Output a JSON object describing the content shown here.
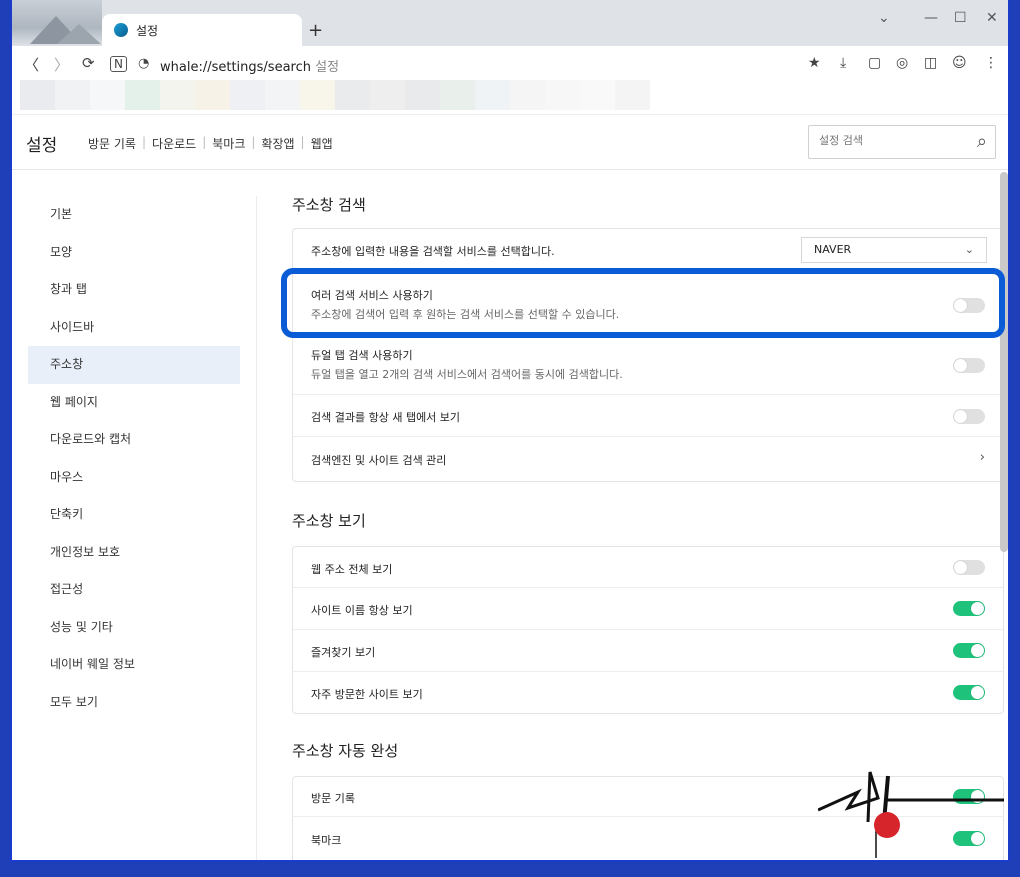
{
  "tab": {
    "title": "설정",
    "new_tab": "+"
  },
  "window_controls": {
    "dropdown": "⌄",
    "minimize": "—",
    "maximize": "☐",
    "close": "✕"
  },
  "addressbar": {
    "url_main": "whale://settings/search",
    "url_sub": "설정"
  },
  "bookmark_colors": [
    "#e9ebee",
    "#f1f2f4",
    "#f6f7f9",
    "#e4f1ea",
    "#f4f4ee",
    "#f7f2e8",
    "#eef0f4",
    "#f3f4f6",
    "#f8f5ea",
    "#eaebed",
    "#eeeeee",
    "#e8eaec",
    "#e9f0ec",
    "#f0f3f5",
    "#f5f5f5",
    "#f7f7f7",
    "#f9f9f9",
    "#f4f4f4"
  ],
  "header": {
    "title": "설정",
    "links": [
      "방문 기록",
      "다운로드",
      "북마크",
      "확장앱",
      "웹앱"
    ],
    "search_placeholder": "설정 검색"
  },
  "sidebar": {
    "items": [
      {
        "label": "기본"
      },
      {
        "label": "모양"
      },
      {
        "label": "창과 탭"
      },
      {
        "label": "사이드바"
      },
      {
        "label": "주소창",
        "active": true
      },
      {
        "label": "웹 페이지"
      },
      {
        "label": "다운로드와 캡처"
      },
      {
        "label": "마우스"
      },
      {
        "label": "단축키"
      },
      {
        "label": "개인정보 보호"
      },
      {
        "label": "접근성"
      },
      {
        "label": "성능 및 기타"
      },
      {
        "label": "네이버 웨일 정보"
      },
      {
        "label": "모두 보기"
      }
    ]
  },
  "sections": {
    "search": {
      "title": "주소창 검색",
      "engine_label": "주소창에 입력한 내용을 검색할 서비스를 선택합니다.",
      "engine_value": "NAVER",
      "multi_label": "여러 검색 서비스 사용하기",
      "multi_sub": "주소창에 검색어 입력 후 원하는 검색 서비스를 선택할 수 있습니다.",
      "dual_label": "듀얼 탭 검색 사용하기",
      "dual_sub": "듀얼 탭을 열고 2개의 검색 서비스에서 검색어를 동시에 검색합니다.",
      "newtab_label": "검색 결과를 항상 새 탭에서 보기",
      "manage_label": "검색엔진 및 사이트 검색 관리"
    },
    "view": {
      "title": "주소창 보기",
      "rows": [
        {
          "label": "웹 주소 전체 보기",
          "on": false
        },
        {
          "label": "사이트 이름 항상 보기",
          "on": true
        },
        {
          "label": "즐겨찾기 보기",
          "on": true
        },
        {
          "label": "자주 방문한 사이트 보기",
          "on": true
        }
      ]
    },
    "autocomplete": {
      "title": "주소창 자동 완성",
      "rows": [
        {
          "label": "방문 기록",
          "on": true
        },
        {
          "label": "북마크",
          "on": true
        }
      ]
    }
  },
  "signature_text": "시아"
}
